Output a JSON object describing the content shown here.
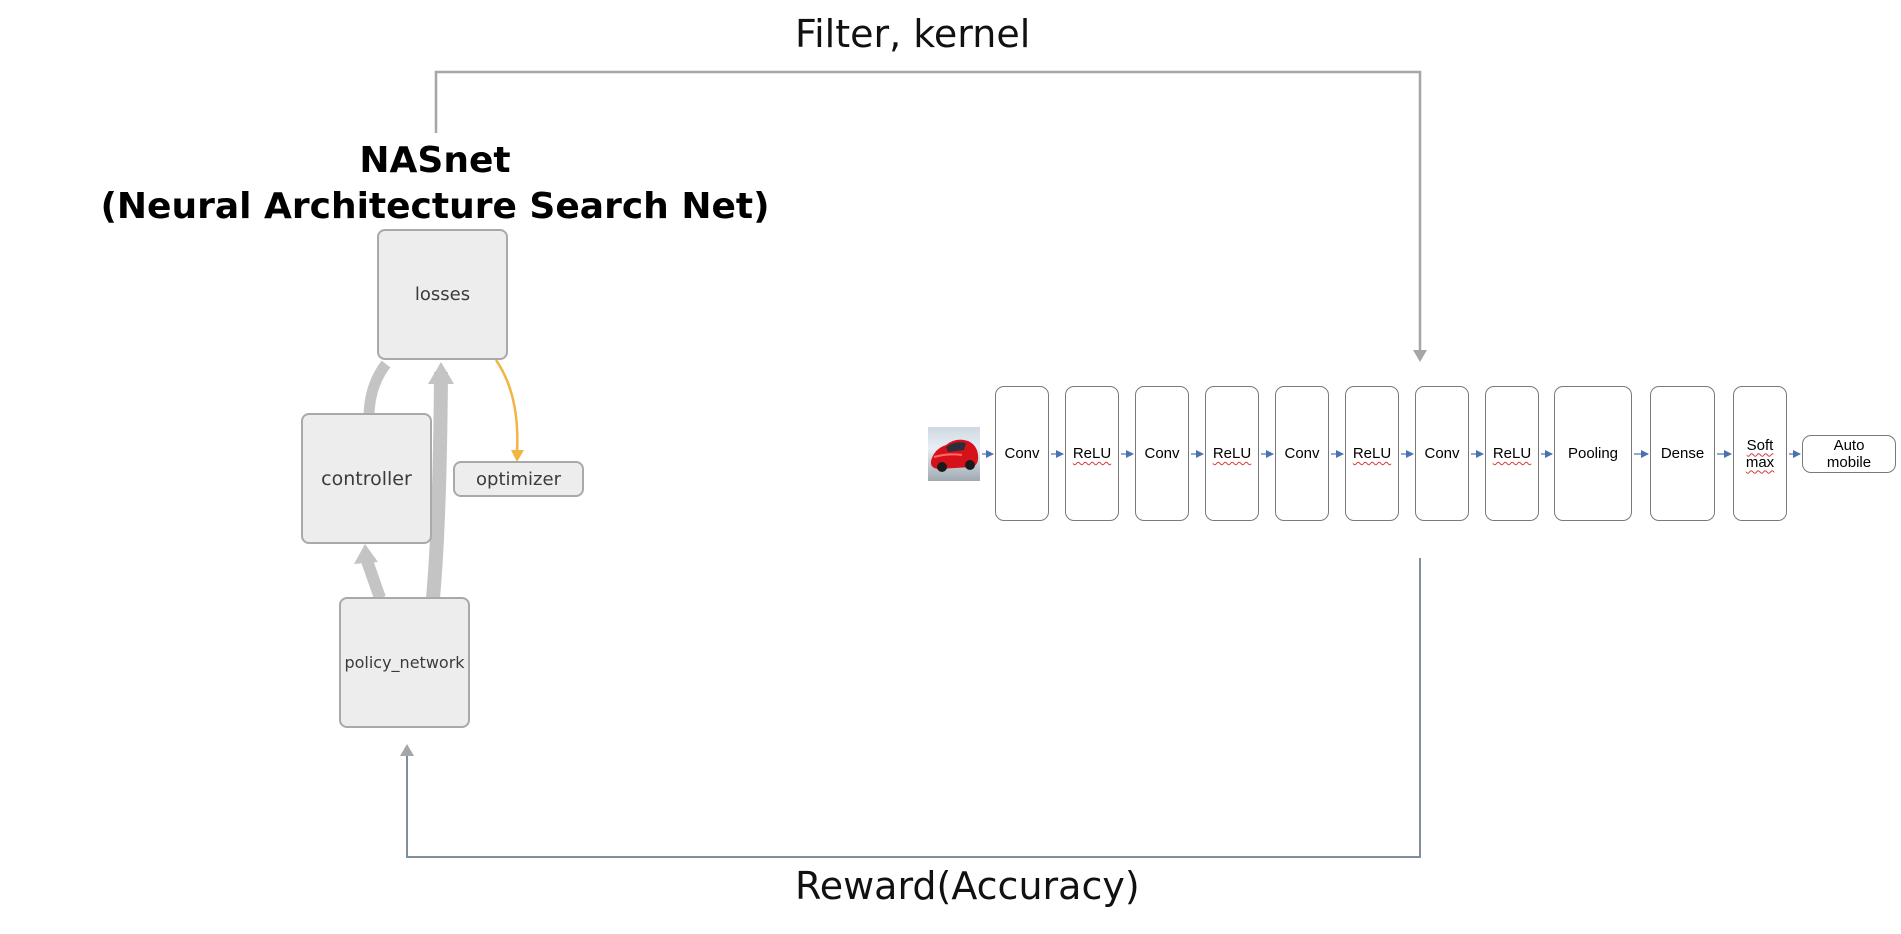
{
  "title": {
    "line1": "NASnet",
    "line2": "(Neural Architecture Search Net)"
  },
  "feedback": {
    "top_label": "Filter, kernel",
    "bottom_label": "Reward(Accuracy)"
  },
  "graph": {
    "nodes": {
      "losses": "losses",
      "controller": "controller",
      "optimizer": "optimizer",
      "policy_network": "policy_network"
    }
  },
  "pipeline": {
    "input_image": "red-car-photo",
    "layers": [
      {
        "line1": "Conv",
        "line2": ""
      },
      {
        "line1": "ReLU",
        "line2": ""
      },
      {
        "line1": "Conv",
        "line2": ""
      },
      {
        "line1": "ReLU",
        "line2": ""
      },
      {
        "line1": "Conv",
        "line2": ""
      },
      {
        "line1": "ReLU",
        "line2": ""
      },
      {
        "line1": "Conv",
        "line2": ""
      },
      {
        "line1": "ReLU",
        "line2": ""
      },
      {
        "line1": "Pooling",
        "line2": ""
      },
      {
        "line1": "Dense",
        "line2": ""
      },
      {
        "line1": "Soft",
        "line2": "max"
      }
    ],
    "output": {
      "line1": "Auto",
      "line2": "mobile"
    }
  },
  "colors": {
    "edge_gray": "#b5b5b5",
    "edge_orange": "#f2b544",
    "feedback_line": "#a6a6a6",
    "pipeline_arrow": "#4a72b0"
  }
}
